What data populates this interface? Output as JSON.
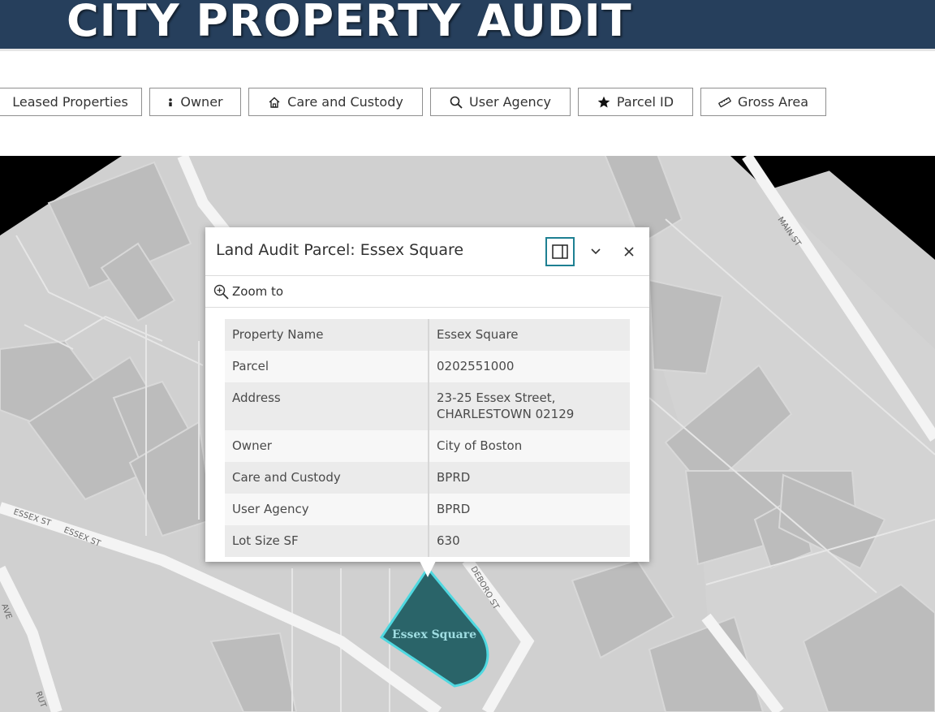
{
  "header": {
    "title": "CITY PROPERTY AUDIT",
    "bg_color": "#263f5c"
  },
  "toolbar": {
    "buttons": [
      {
        "label": "Leased Properties",
        "icon": "none"
      },
      {
        "label": "Owner",
        "icon": "person-icon"
      },
      {
        "label": "Care and Custody",
        "icon": "home-icon"
      },
      {
        "label": "User Agency",
        "icon": "search-icon"
      },
      {
        "label": "Parcel ID",
        "icon": "star-icon"
      },
      {
        "label": "Gross Area",
        "icon": "ruler-icon"
      }
    ]
  },
  "map": {
    "street_labels": [
      "MAIN ST",
      "ESSEX ST",
      "ESSEX ST",
      "DEBORO ST",
      "AVE",
      "RUT"
    ],
    "highlighted_parcel_label": "Essex Square",
    "highlight_fill": "#2a6469",
    "highlight_stroke": "#4fd8e0"
  },
  "popup": {
    "title": "Land Audit Parcel: Essex Square",
    "zoom_to": "Zoom to",
    "accent_color": "#1e8092",
    "attributes": [
      {
        "key": "Property Name",
        "value": "Essex Square"
      },
      {
        "key": "Parcel",
        "value": "0202551000"
      },
      {
        "key": "Address",
        "value": "23-25 Essex Street,\nCHARLESTOWN 02129"
      },
      {
        "key": "Owner",
        "value": "City of Boston"
      },
      {
        "key": "Care and Custody",
        "value": "BPRD"
      },
      {
        "key": "User Agency",
        "value": "BPRD"
      },
      {
        "key": "Lot Size SF",
        "value": "630"
      }
    ]
  }
}
